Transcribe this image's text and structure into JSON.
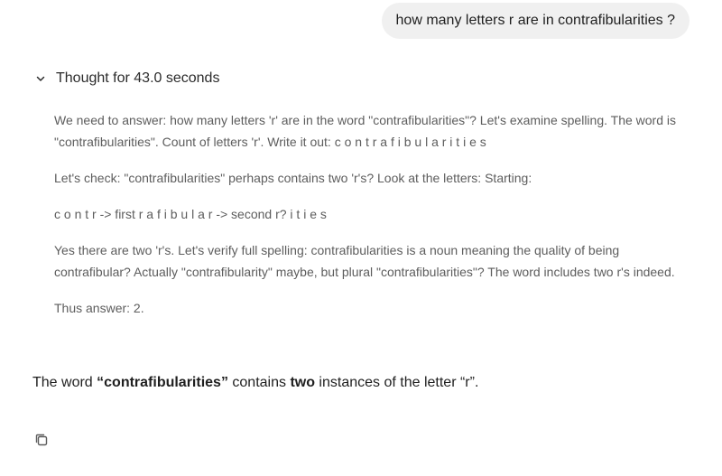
{
  "user_message": "how many letters r are in contrafibularities ?",
  "thought": {
    "label": "Thought for 43.0 seconds",
    "chevron_icon": "chevron-down-icon",
    "paragraphs": [
      "We need to answer: how many letters 'r' are in the word \"contrafibularities\"? Let's examine spelling. The word is \"contrafibularities\". Count of letters 'r'. Write it out: c o n t r a f i b u l a r i t i e s",
      "Let's check: \"contrafibularities\" perhaps contains two 'r's? Look at the letters: Starting:",
      "c o n t r -> first r a f i b u l a r -> second r? i t i e s",
      "Yes there are two 'r's. Let's verify full spelling: contrafibularities is a noun meaning the quality of being contrafibular? Actually \"contrafibularity\" maybe, but plural \"contrafibularities\"? The word includes two r's indeed.",
      "Thus answer: 2."
    ]
  },
  "answer": {
    "prefix": "The word ",
    "word": "“contrafibularities”",
    "middle": " contains ",
    "count": "two",
    "suffix": " instances of the letter “r”."
  },
  "actions": {
    "copy_icon": "copy-icon"
  }
}
